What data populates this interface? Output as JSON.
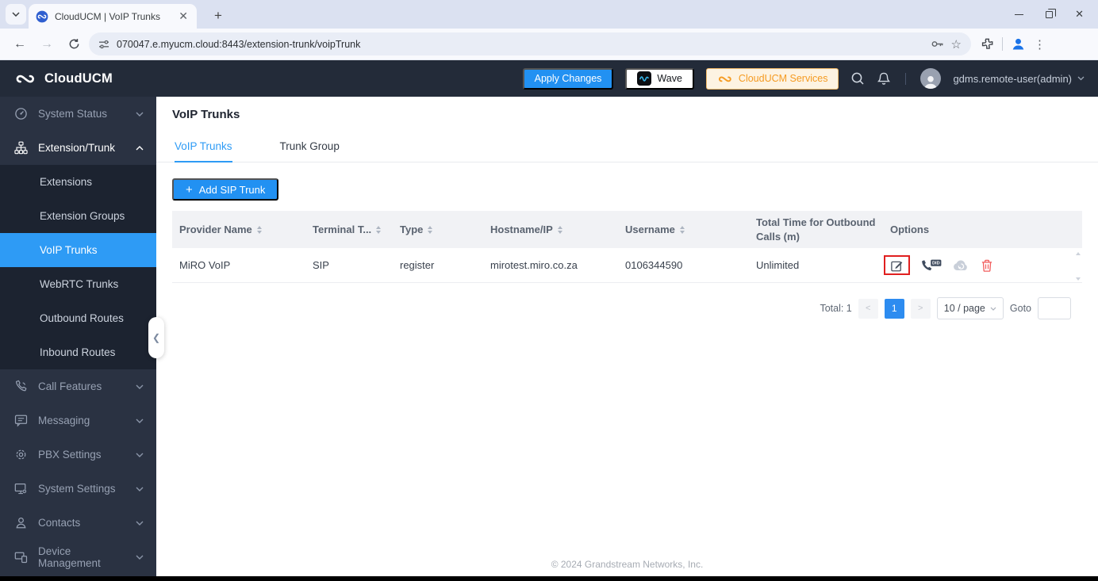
{
  "browser": {
    "tab_title": "CloudUCM | VoIP Trunks",
    "url": "070047.e.myucm.cloud:8443/extension-trunk/voipTrunk"
  },
  "app_header": {
    "brand": "CloudUCM",
    "apply_changes_label": "Apply Changes",
    "wave_label": "Wave",
    "services_label": "CloudUCM Services",
    "username": "gdms.remote-user(admin)"
  },
  "sidebar": {
    "top_items": [
      {
        "label": "System Status"
      },
      {
        "label": "Extension/Trunk"
      }
    ],
    "submenu_items": [
      {
        "label": "Extensions"
      },
      {
        "label": "Extension Groups"
      },
      {
        "label": "VoIP Trunks"
      },
      {
        "label": "WebRTC Trunks"
      },
      {
        "label": "Outbound Routes"
      },
      {
        "label": "Inbound Routes"
      }
    ],
    "bottom_items": [
      {
        "label": "Call Features"
      },
      {
        "label": "Messaging"
      },
      {
        "label": "PBX Settings"
      },
      {
        "label": "System Settings"
      },
      {
        "label": "Contacts"
      },
      {
        "label": "Device Management"
      }
    ],
    "active_item": "VoIP Trunks"
  },
  "main": {
    "page_title": "VoIP Trunks",
    "tabs": [
      {
        "label": "VoIP Trunks"
      },
      {
        "label": "Trunk Group"
      }
    ],
    "active_tab": "VoIP Trunks",
    "add_button": {
      "plus": "+",
      "label": "Add SIP Trunk"
    },
    "table": {
      "headers": [
        {
          "label": "Provider Name"
        },
        {
          "label": "Terminal T..."
        },
        {
          "label": "Type"
        },
        {
          "label": "Hostname/IP"
        },
        {
          "label": "Username"
        },
        {
          "label": "Total Time for Outbound Calls (m)"
        },
        {
          "label": "Options"
        }
      ],
      "rows": [
        {
          "provider_name": "MiRO VoIP",
          "terminal_type": "SIP",
          "type": "register",
          "hostname_ip": "mirotest.miro.co.za",
          "username": "0106344590",
          "total_time": "Unlimited"
        }
      ]
    },
    "pagination": {
      "total_label": "Total: 1",
      "prev": "<",
      "current_page": "1",
      "next": ">",
      "page_size": "10 / page",
      "goto_label": "Goto"
    }
  },
  "footer": {
    "copyright": "© 2024 Grandstream Networks, Inc."
  },
  "colors": {
    "accent_blue": "#2291f2",
    "services_orange": "#f59b22",
    "danger_red": "#f25e5e",
    "annotation_red": "#e01f1f",
    "header_navy": "#232b39",
    "sidebar_navy": "#2a3242"
  }
}
